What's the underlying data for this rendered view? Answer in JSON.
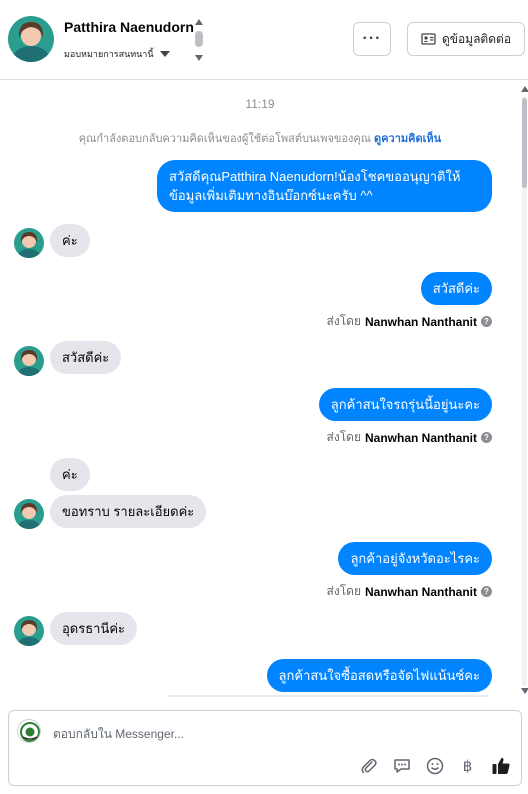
{
  "header": {
    "name": "Patthira Naenudorn",
    "assign_label": "มอบหมายการสนทนานี้",
    "more_label": "···",
    "contact_label": "ดูข้อมูลติดต่อ"
  },
  "thread": {
    "time": "11:19",
    "notice_text": "คุณกำลังตอบกลับความคิดเห็นของผู้ใช้ต่อโพสต์บนเพจของคุณ",
    "notice_link": "ดูความคิดเห็น",
    "messages": [
      {
        "dir": "out",
        "text": "สวัสดีคุณPatthira Naenudorn!น้องโชคขออนุญาติให้ข้อมูลเพิ่มเติมทางอินบ๊อกซ์นะครับ ^^"
      },
      {
        "dir": "in",
        "text": "ค่ะ"
      },
      {
        "dir": "out",
        "text": "สวัสดีค่ะ",
        "sent_by_prefix": "ส่งโดย",
        "sent_by_name": "Nanwhan Nanthanit"
      },
      {
        "dir": "in",
        "text": "สวัสดีค่ะ"
      },
      {
        "dir": "out",
        "text": "ลูกค้าสนใจรถรุ่นนี้อยู่นะคะ",
        "sent_by_prefix": "ส่งโดย",
        "sent_by_name": "Nanwhan Nanthanit"
      },
      {
        "dir": "in",
        "text": "ค่ะ"
      },
      {
        "dir": "in",
        "text": "ขอทราบ รายละเอียดค่ะ"
      },
      {
        "dir": "out",
        "text": "ลูกค้าอยู่จังหวัดอะไรคะ",
        "sent_by_prefix": "ส่งโดย",
        "sent_by_name": "Nanwhan Nanthanit"
      },
      {
        "dir": "in",
        "text": "อุดรธานีค่ะ"
      },
      {
        "dir": "out",
        "text": "ลูกค้าสนใจซื้อสดหรือจัดไฟแน้นซ์คะ"
      }
    ]
  },
  "composer": {
    "placeholder": "ตอบกลับใน Messenger...",
    "tools": [
      "paperclip-icon",
      "chat-bubble-icon",
      "smiley-icon",
      "baht-icon",
      "thumbs-up-icon"
    ],
    "baht_glyph": "฿"
  },
  "colors": {
    "outgoing_bubble": "#0084ff",
    "incoming_bubble": "#e4e6eb",
    "link": "#216fdb"
  }
}
